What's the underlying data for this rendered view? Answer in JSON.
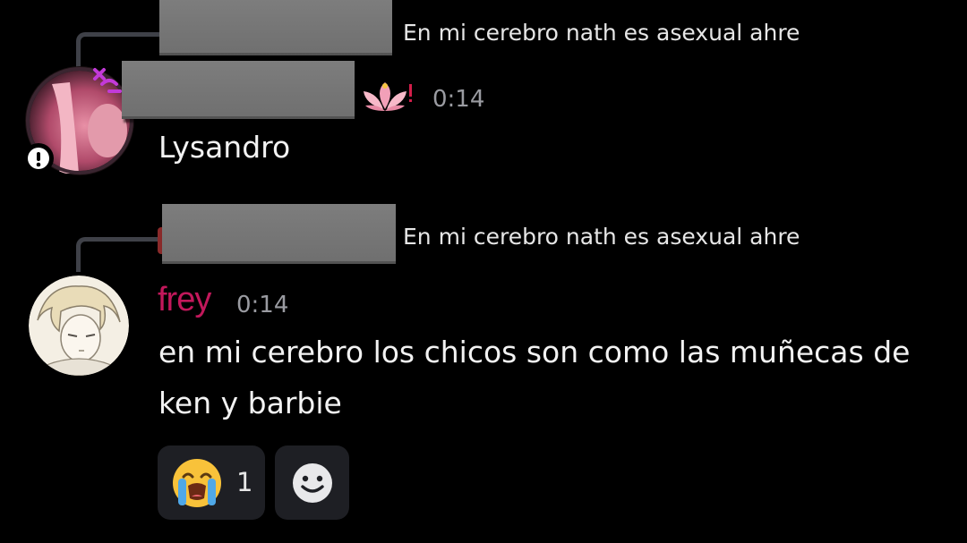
{
  "messages": [
    {
      "reply_preview": "En mi cerebro nath es asexual ahre",
      "author_badge_icon": "lotus-flower-icon",
      "timestamp": "0:14",
      "text": "Lysandro",
      "avatar_status_icon": "exclamation-badge-icon"
    },
    {
      "reply_preview": "En mi cerebro nath es asexual ahre",
      "author": "frey",
      "author_color": "#c2185b",
      "timestamp": "0:14",
      "text_line1": "en mi cerebro los chicos son como las muñecas de",
      "text_line2": "ken y barbie",
      "reactions": [
        {
          "emoji": "😭",
          "icon": "loudly-crying-emoji-icon",
          "count": "1"
        },
        {
          "icon": "add-reaction-smiley-icon"
        }
      ]
    }
  ]
}
